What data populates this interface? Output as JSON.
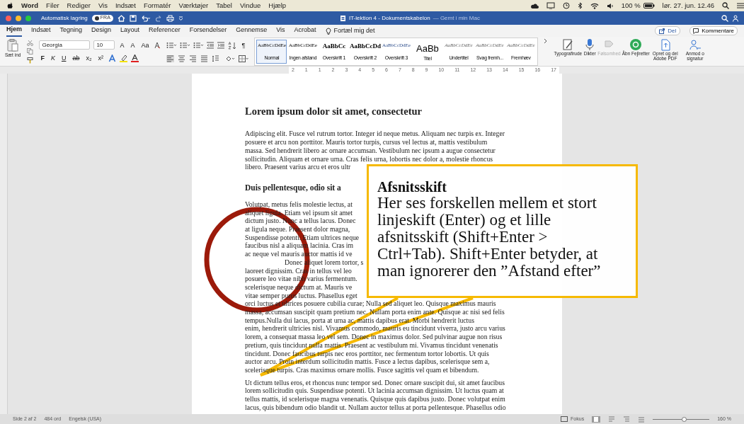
{
  "menu_bar": {
    "app": "Word",
    "items": [
      "Filer",
      "Rediger",
      "Vis",
      "Indsæt",
      "Formatér",
      "Værktøjer",
      "Tabel",
      "Vindue",
      "Hjælp"
    ],
    "battery": "100 %",
    "clock": "lør. 27. jun. 12.46"
  },
  "window": {
    "autosave_label": "Automatisk lagring",
    "autosave_state": "FRA",
    "autosave_on": false,
    "title": "IT-lektion 4 - Dokumentskabelon",
    "saved_note": "— Gemt i min Mac"
  },
  "tabs": [
    {
      "label": "Hjem",
      "selected": true
    },
    {
      "label": "Indsæt",
      "selected": false
    },
    {
      "label": "Tegning",
      "selected": false
    },
    {
      "label": "Design",
      "selected": false
    },
    {
      "label": "Layout",
      "selected": false
    },
    {
      "label": "Referencer",
      "selected": false
    },
    {
      "label": "Forsendelser",
      "selected": false
    },
    {
      "label": "Gennemse",
      "selected": false
    },
    {
      "label": "Vis",
      "selected": false
    },
    {
      "label": "Acrobat",
      "selected": false
    }
  ],
  "tell_me": "Fortæl mig det",
  "share_button": "Del",
  "comments_button": "Kommentare",
  "ribbon": {
    "paste_label": "Sæt ind",
    "font_name": "Georgia",
    "font_size": "10",
    "font_top": [
      "A",
      "A",
      "Aa"
    ],
    "font_bottom": [
      "F",
      "K",
      "U",
      "ab",
      "x₂",
      "x²"
    ],
    "pilcrow": "¶",
    "styles": [
      {
        "preview": "AaBbCcDdEe",
        "name": "Normal",
        "selected": true
      },
      {
        "preview": "AaBbCcDdEe",
        "name": "Ingen afstand",
        "selected": false
      },
      {
        "preview": "AaBbCc",
        "name": "Overskrift 1",
        "selected": false
      },
      {
        "preview": "AaBbCcDd",
        "name": "Overskrift 2",
        "selected": false
      },
      {
        "preview": "AaBbCcDdEe",
        "name": "Overskrift 3",
        "selected": false
      },
      {
        "preview": "AaBb",
        "name": "Titel",
        "selected": false
      },
      {
        "preview": "AaBbCcDdEe",
        "name": "Undertitel",
        "selected": false
      },
      {
        "preview": "AaBbCcDdEe",
        "name": "Svag fremh...",
        "selected": false
      },
      {
        "preview": "AaBbCcDdEe",
        "name": "Fremhæv",
        "selected": false
      }
    ],
    "actions": [
      {
        "label": "Typografirude",
        "disabled": false
      },
      {
        "label": "Dikter",
        "disabled": false
      },
      {
        "label": "Følsomhed",
        "disabled": true
      },
      {
        "label": "Åbn Fejlretter",
        "disabled": false
      },
      {
        "label": "Opret og del Adobe PDF",
        "disabled": false
      },
      {
        "label": "Anmod o signatur",
        "disabled": false
      }
    ]
  },
  "ruler": [
    "2",
    "1",
    "1",
    "2",
    "3",
    "4",
    "5",
    "6",
    "7",
    "8",
    "9",
    "10",
    "11",
    "12",
    "13",
    "14",
    "15",
    "16",
    "17"
  ],
  "document": [
    {
      "kind": "heading1",
      "lines": [
        "Lorem ipsum dolor sit amet, consectetur"
      ],
      "first_line_indent": false,
      "space_after": true
    },
    {
      "kind": "paragraph",
      "lines": [
        "Adipiscing elit. Fusce vel rutrum tortor. Integer id neque metus. Aliquam nec turpis ex. Integer",
        "posuere et arcu non porttitor. Mauris tortor turpis, cursus vel lectus at, mattis vestibulum",
        "massa. Sed hendrerit libero ac ornare accumsan. Vestibulum nec ipsum a augue consectetur",
        "sollicitudin. Aliquam et ornare urna. Cras felis urna, lobortis nec dolor a, molestie rhoncus",
        "libero. Praesent varius arcu et eros ultr"
      ],
      "first_line_indent": false,
      "space_after": true
    },
    {
      "kind": "heading2",
      "lines": [
        "Duis pellentesque, odio sit a"
      ],
      "first_line_indent": false,
      "space_after": true
    },
    {
      "kind": "paragraph",
      "lines": [
        "Volutpat, metus felis molestie lectus, at",
        "aliquet ligula. Etiam vel ipsum sit amet",
        "dictum justo. Nunc a tellus lacus. Donec",
        "at ligula neque. Praesent dolor magna,",
        "Suspendisse potenti. Etiam ultrices neque",
        "faucibus nisl a aliquam lacinia. Cras im",
        "ac neque vel mauris auctor mattis id ve"
      ],
      "first_line_indent": false,
      "space_after": false
    },
    {
      "kind": "paragraph",
      "lines": [
        "Donec aliquet lorem tortor, s",
        "laoreet dignissim. Cras in tellus vel leo",
        "posuere leo vitae nibh varius fermentum.",
        "scelerisque neque dictum at. Mauris ve",
        "vitae semper purus luctus. Phasellus eget",
        "orci luctus et ultrices posuere cubilia curae; Nulla sed aliquet leo. Quisque maximus mauris",
        "massa, accumsan suscipit quam pretium nec. Nullam porta enim ante. Quisque ac nisi sed felis",
        "tempus.Nulla dui lacus, porta at urna ac, mattis dapibus erat. Morbi hendrerit luctus",
        "enim, hendrerit ultricies nisl. Vivamus commodo, mauris eu tincidunt viverra, justo arcu varius",
        "lorem, a consequat massa leo vel sem. Donec in maximus dolor. Sed pulvinar augue non risus",
        "pretium, quis tincidunt nulla mattis. Praesent ac vestibulum mi. Vivamus tincidunt venenatis",
        "tincidunt. Donec faucibus turpis nec eros porttitor, nec fermentum tortor lobortis. Ut quis",
        "auctor arcu. Proin interdum sollicitudin mattis. Fusce a lectus dapibus, scelerisque sem a,",
        "scelerisque turpis. Cras maximus ornare mollis. Fusce sagittis vel quam et bibendum."
      ],
      "first_line_indent": true,
      "space_after": true
    },
    {
      "kind": "paragraph",
      "lines": [
        "Ut dictum tellus eros, et rhoncus nunc tempor sed. Donec ornare suscipit dui, sit amet faucibus",
        "lorem sollicitudin quis. Suspendisse potenti. Ut lacinia accumsan dignissim. Ut luctus quam at",
        "tellus mattis, id scelerisque magna venenatis. Quisque quis dapibus justo. Donec volutpat enim",
        "lacus, quis bibendum odio blandit ut. Nullam auctor tellus at porta pellentesque. Phasellus odio"
      ],
      "first_line_indent": false,
      "space_after": true
    }
  ],
  "callout": {
    "title": "Afsnitsskift",
    "body": "Her ses forskellen mellem et stort linjeskift (Enter) og et lille afsnitsskift (Shift+Enter > Ctrl+Tab). Shift+Enter betyder, at man ignorerer den ”Afstand efter”"
  },
  "status_bar": {
    "page": "Side 2 af 2",
    "words": "484 ord",
    "language": "Engelsk (USA)",
    "focus": "Fokus",
    "zoom": "160 %",
    "zoom_slider": {
      "level": 0.55
    }
  }
}
